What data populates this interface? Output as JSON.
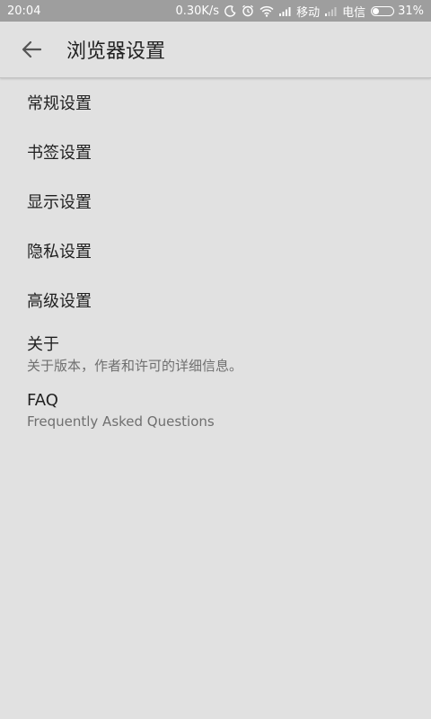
{
  "status_bar": {
    "time": "20:04",
    "speed": "0.30K/s",
    "carrier1": "移动",
    "carrier2": "电信",
    "battery_text": "31%",
    "battery_level": 0.31
  },
  "header": {
    "title": "浏览器设置"
  },
  "settings": {
    "items": [
      {
        "title": "常规设置"
      },
      {
        "title": "书签设置"
      },
      {
        "title": "显示设置"
      },
      {
        "title": "隐私设置"
      },
      {
        "title": "高级设置"
      },
      {
        "title": "关于",
        "subtitle": "关于版本，作者和许可的详细信息。"
      },
      {
        "title": "FAQ",
        "subtitle": "Frequently Asked Questions"
      }
    ]
  }
}
